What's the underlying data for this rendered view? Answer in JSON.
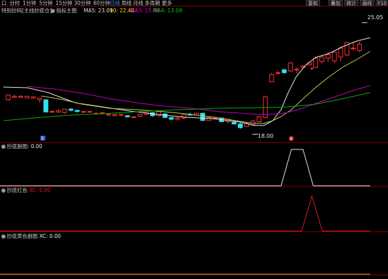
{
  "toolbar": {
    "items": [
      "口",
      "分时",
      "1分钟",
      "5分钟",
      "15分钟",
      "30分钟",
      "60分钟",
      "日线",
      "周线",
      "月线",
      "多周期",
      "更多"
    ],
    "active_index": 7,
    "right_buttons": [
      "复权",
      "叠加",
      "统计",
      "画线",
      "F10"
    ]
  },
  "main_panel": {
    "stock_label": "特别抄码[主线抄底仓]",
    "indicator_name": "指标主图",
    "ma_values": [
      {
        "text": "MA5: 23.09",
        "color": "#e0e0e0"
      },
      {
        "text": "10: 22.40",
        "color": "#e6e600"
      },
      {
        "text": "MA3: 15.88",
        "color": "#e000e0"
      },
      {
        "text": "MA4: 13.09",
        "color": "#00d000"
      }
    ],
    "high_label": "25.05",
    "low_label": "18.00"
  },
  "chart_data": {
    "type": "candlestick",
    "ylim": [
      17.2,
      26.3
    ],
    "candles": [
      [
        19.98,
        20.33,
        19.93,
        20.38
      ],
      [
        20.16,
        20.24,
        20.13,
        20.38
      ],
      [
        20.16,
        20.24,
        20.11,
        20.33
      ],
      [
        20.11,
        20.24,
        20.11,
        20.29
      ],
      [
        20.11,
        20.2,
        20.07,
        20.24
      ],
      [
        19.98,
        20.11,
        19.75,
        20.11
      ],
      [
        19.98,
        19.07,
        19.07,
        20.02
      ],
      [
        19.07,
        19.11,
        19.02,
        19.2
      ],
      [
        19.07,
        19.16,
        19.02,
        19.29
      ],
      [
        19.02,
        19.29,
        18.93,
        19.29
      ],
      [
        19.29,
        19.2,
        19.11,
        19.38
      ],
      [
        19.2,
        19.11,
        19.02,
        19.2
      ],
      [
        19.11,
        19.11,
        18.98,
        19.11
      ],
      [
        19.07,
        19.11,
        19.02,
        19.11
      ],
      [
        18.98,
        18.98,
        18.93,
        19.02
      ],
      [
        18.98,
        19.02,
        18.93,
        19.07
      ],
      [
        18.89,
        18.89,
        18.8,
        18.93
      ],
      [
        18.8,
        18.89,
        18.75,
        18.89
      ],
      [
        18.84,
        18.89,
        18.75,
        18.93
      ],
      [
        18.8,
        18.71,
        18.66,
        18.84
      ],
      [
        18.71,
        18.71,
        18.66,
        18.75
      ],
      [
        18.75,
        18.89,
        18.71,
        18.93
      ],
      [
        18.89,
        19.02,
        18.84,
        19.07
      ],
      [
        19.02,
        18.8,
        18.71,
        19.07
      ],
      [
        18.8,
        19.11,
        18.71,
        19.11
      ],
      [
        18.93,
        18.66,
        18.62,
        18.98
      ],
      [
        18.66,
        18.53,
        18.49,
        18.71
      ],
      [
        18.53,
        18.62,
        18.4,
        18.71
      ],
      [
        18.62,
        18.89,
        18.53,
        18.98
      ],
      [
        18.89,
        18.84,
        18.8,
        19.02
      ],
      [
        18.84,
        18.98,
        18.8,
        19.02
      ],
      [
        18.98,
        18.44,
        18.4,
        19.02
      ],
      [
        18.44,
        18.66,
        18.44,
        18.75
      ],
      [
        18.62,
        18.62,
        18.53,
        18.66
      ],
      [
        18.62,
        18.35,
        18.31,
        18.66
      ],
      [
        18.35,
        18.53,
        18.22,
        18.53
      ],
      [
        18.31,
        18.18,
        18.13,
        18.35
      ],
      [
        18.18,
        17.91,
        17.82,
        18.26
      ],
      [
        18.0,
        18.22,
        18.0,
        18.31
      ],
      [
        18.13,
        18.4,
        18.09,
        18.49
      ],
      [
        18.35,
        18.71,
        18.31,
        18.8
      ],
      [
        18.66,
        20.2,
        18.62,
        20.29
      ],
      [
        21.33,
        21.86,
        21.29,
        22.0
      ],
      [
        21.95,
        22.0,
        21.86,
        22.13
      ],
      [
        22.22,
        22.0,
        21.95,
        22.31
      ],
      [
        22.13,
        22.73,
        22.09,
        22.82
      ],
      [
        22.22,
        22.26,
        21.95,
        22.4
      ],
      [
        22.4,
        22.49,
        22.31,
        22.58
      ],
      [
        22.58,
        22.73,
        22.53,
        22.82
      ],
      [
        22.4,
        23.08,
        22.35,
        23.22
      ],
      [
        22.84,
        23.17,
        22.71,
        23.31
      ],
      [
        23.08,
        23.35,
        22.8,
        23.57
      ],
      [
        22.89,
        23.53,
        22.71,
        23.57
      ],
      [
        23.17,
        23.84,
        22.84,
        23.97
      ],
      [
        23.33,
        24.26,
        23.22,
        24.31
      ],
      [
        23.84,
        23.84,
        23.66,
        24.31
      ],
      [
        23.66,
        24.13,
        23.53,
        24.31
      ]
    ]
  },
  "sub_panels": [
    {
      "title": "抄底副图",
      "value_label": ": 0.00"
    },
    {
      "title": "抄底红色",
      "value_label": "XC: 0.00"
    },
    {
      "title": "抄底黄色副图",
      "value_label": "XC: 0.00"
    }
  ],
  "markers": {
    "s_mark": "S",
    "flag_mark": "B"
  }
}
